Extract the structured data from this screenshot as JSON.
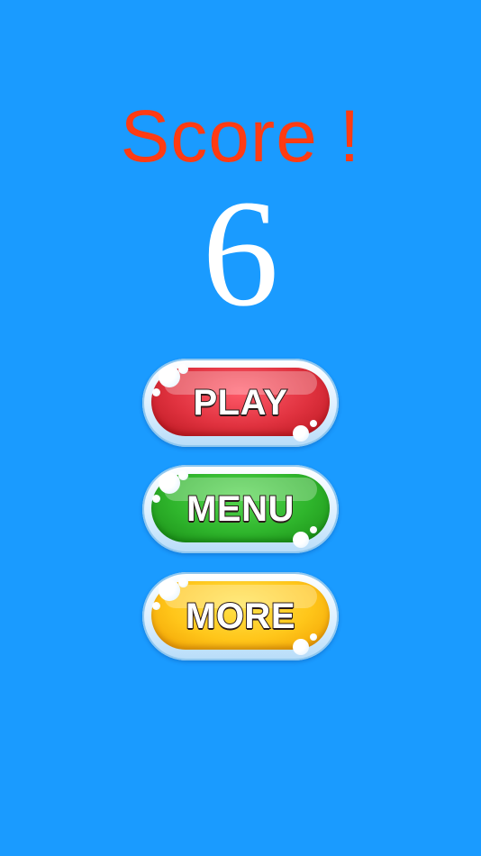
{
  "screen": {
    "title": "Score !",
    "score": "6"
  },
  "buttons": {
    "play": "PLAY",
    "menu": "MENU",
    "more": "MORE"
  },
  "colors": {
    "background": "#1a9bff",
    "title": "#ff3b12",
    "score": "#ffffff",
    "play": "#e0323f",
    "menu": "#2fb52c",
    "more": "#ffc61a"
  },
  "icons": [
    "bubble-highlight-icon"
  ]
}
